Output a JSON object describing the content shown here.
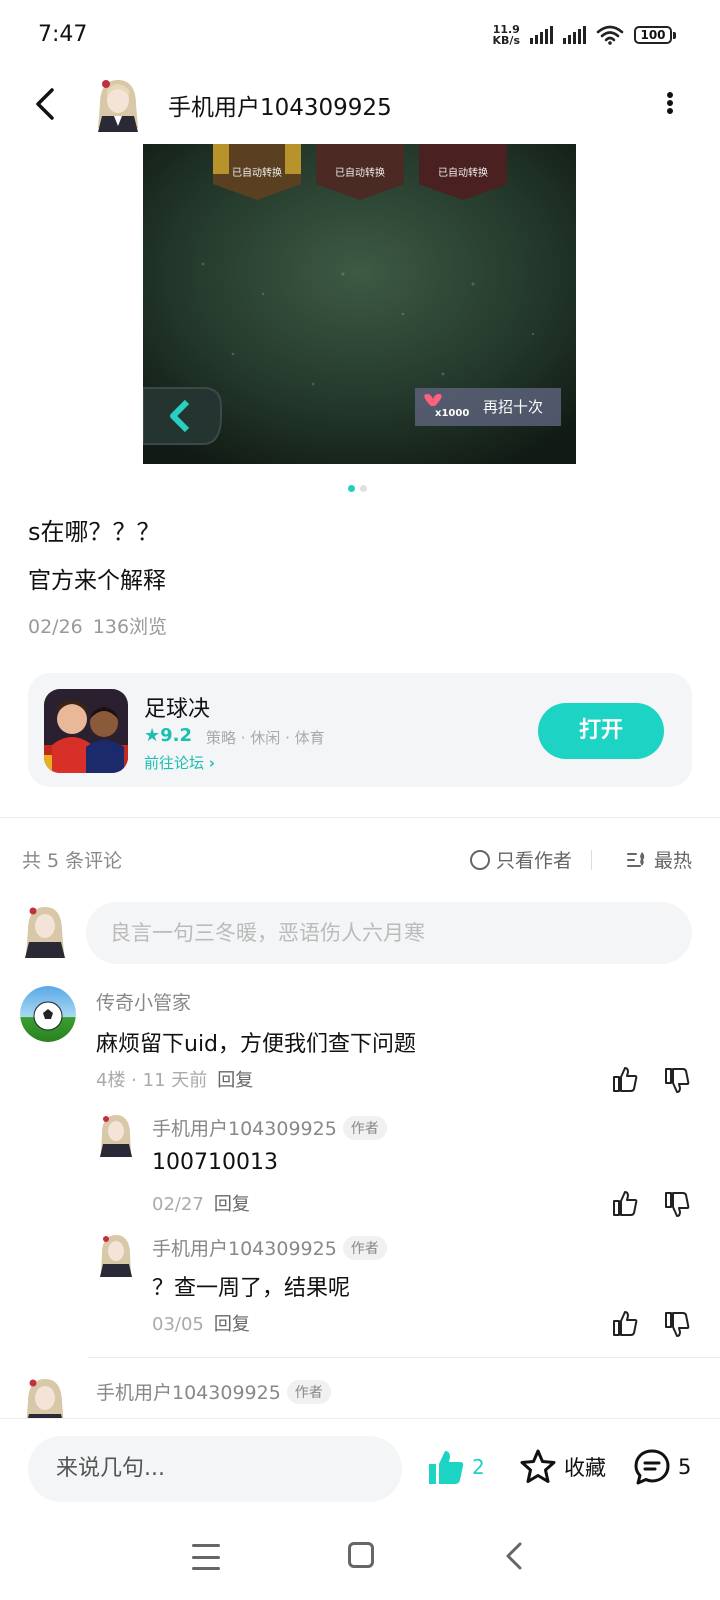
{
  "status": {
    "time": "7:47",
    "net_speed_value": "11.9",
    "net_speed_unit": "KB/s",
    "battery": "100"
  },
  "header": {
    "username": "手机用户104309925"
  },
  "post": {
    "image_badge": "已自动转换",
    "image_button": "再招十次",
    "image_cost": "x1000",
    "title": "s在哪？？？",
    "body": "官方来个解释",
    "date": "02/26",
    "views": "136浏览"
  },
  "game": {
    "name": "足球决",
    "rating": "9.2",
    "tags": "策略 · 休闲 · 体育",
    "forum_link": "前往论坛",
    "open_label": "打开"
  },
  "comments_bar": {
    "count_text": "共 5 条评论",
    "only_author": "只看作者",
    "sort_hot": "最热"
  },
  "comment_input": {
    "placeholder": "良言一句三冬暖，恶语伤人六月寒"
  },
  "comments": [
    {
      "name": "传奇小管家",
      "text": "麻烦留下uid，方便我们查下问题",
      "meta": "4楼 · 11 天前",
      "reply": "回复"
    }
  ],
  "replies": [
    {
      "name": "手机用户104309925",
      "tag": "作者",
      "text": "100710013",
      "date": "02/27",
      "reply": "回复"
    },
    {
      "name": "手机用户104309925",
      "tag": "作者",
      "text": "？查一周了，结果呢",
      "date": "03/05",
      "reply": "回复"
    }
  ],
  "next_comment": {
    "name": "手机用户104309925",
    "tag": "作者"
  },
  "bottom_bar": {
    "say_placeholder": "来说几句...",
    "like_count": "2",
    "favorite_label": "收藏",
    "comment_count": "5"
  },
  "colors": {
    "accent": "#1dd3c4",
    "text_muted": "#999999"
  }
}
